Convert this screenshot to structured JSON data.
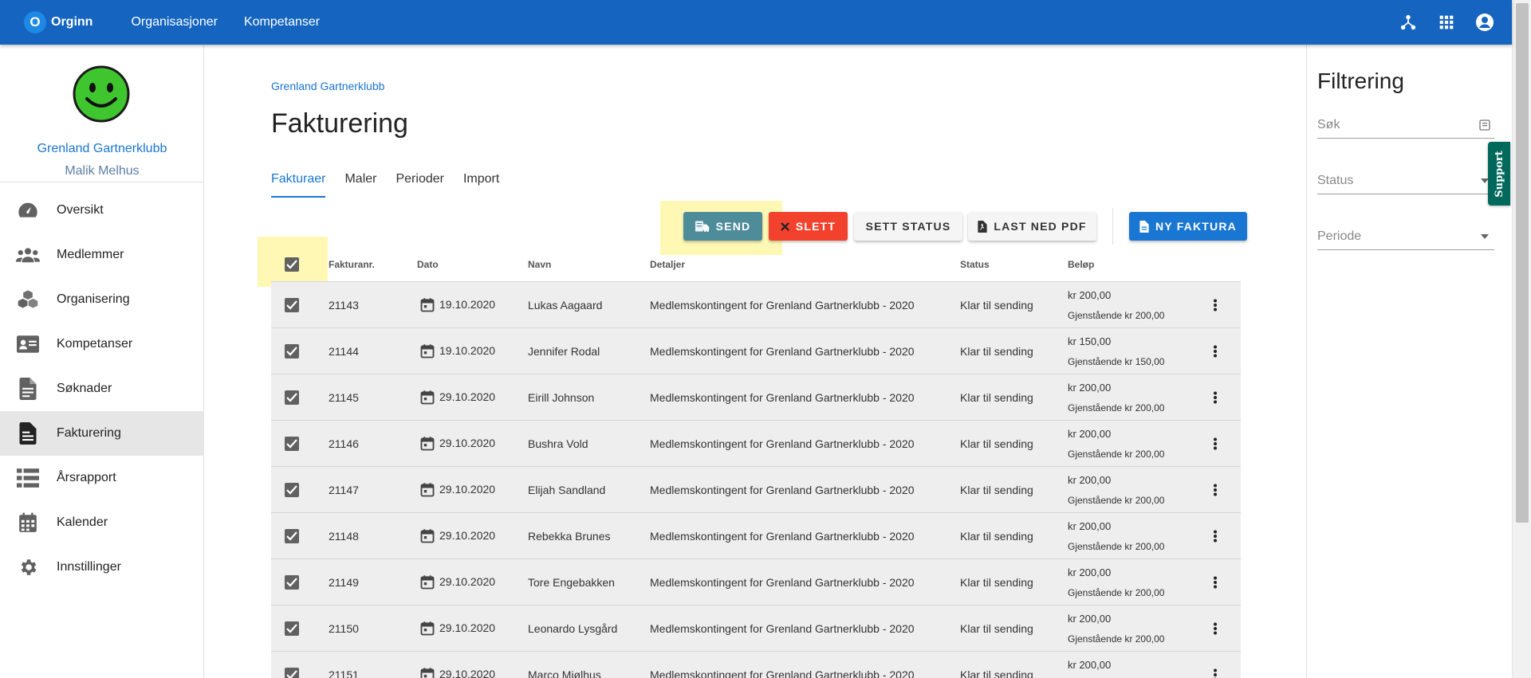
{
  "app": {
    "brand_letter": "O",
    "brand_name": "Orginn",
    "nav": [
      "Organisasjoner",
      "Kompetanser"
    ],
    "icons": [
      "hierarchy-icon",
      "apps-grid-icon",
      "account-circle-icon"
    ]
  },
  "sidebar": {
    "org_name": "Grenland Gartnerklubb",
    "user_name": "Malik Melhus",
    "items": [
      {
        "label": "Oversikt",
        "icon": "dashboard-icon"
      },
      {
        "label": "Medlemmer",
        "icon": "group-icon"
      },
      {
        "label": "Organisering",
        "icon": "boxes-icon"
      },
      {
        "label": "Kompetanser",
        "icon": "id-card-icon"
      },
      {
        "label": "Søknader",
        "icon": "document-icon"
      },
      {
        "label": "Fakturering",
        "icon": "invoice-icon",
        "active": true
      },
      {
        "label": "Årsrapport",
        "icon": "list-icon"
      },
      {
        "label": "Kalender",
        "icon": "calendar-icon"
      },
      {
        "label": "Innstillinger",
        "icon": "gear-icon"
      }
    ]
  },
  "main": {
    "breadcrumb": "Grenland Gartnerklubb",
    "title": "Fakturering",
    "tabs": [
      {
        "label": "Fakturaer",
        "active": true
      },
      {
        "label": "Maler"
      },
      {
        "label": "Perioder"
      },
      {
        "label": "Import"
      }
    ],
    "buttons": {
      "send": "SEND",
      "delete": "SLETT",
      "set_status": "SETT STATUS",
      "download_pdf": "LAST NED PDF",
      "new_invoice": "NY FAKTURA"
    },
    "table": {
      "columns": [
        "Fakturanr.",
        "Dato",
        "Navn",
        "Detaljer",
        "Status",
        "Beløp"
      ],
      "rows": [
        {
          "nr": "21143",
          "date": "19.10.2020",
          "name": "Lukas Aagaard",
          "details": "Medlemskontingent for Grenland Gartnerklubb - 2020",
          "status": "Klar til sending",
          "amount": "kr 200,00",
          "remaining": "Gjenstående kr 200,00"
        },
        {
          "nr": "21144",
          "date": "19.10.2020",
          "name": "Jennifer Rodal",
          "details": "Medlemskontingent for Grenland Gartnerklubb - 2020",
          "status": "Klar til sending",
          "amount": "kr 150,00",
          "remaining": "Gjenstående kr 150,00"
        },
        {
          "nr": "21145",
          "date": "29.10.2020",
          "name": "Eirill Johnson",
          "details": "Medlemskontingent for Grenland Gartnerklubb - 2020",
          "status": "Klar til sending",
          "amount": "kr 200,00",
          "remaining": "Gjenstående kr 200,00"
        },
        {
          "nr": "21146",
          "date": "29.10.2020",
          "name": "Bushra Vold",
          "details": "Medlemskontingent for Grenland Gartnerklubb - 2020",
          "status": "Klar til sending",
          "amount": "kr 200,00",
          "remaining": "Gjenstående kr 200,00"
        },
        {
          "nr": "21147",
          "date": "29.10.2020",
          "name": "Elijah Sandland",
          "details": "Medlemskontingent for Grenland Gartnerklubb - 2020",
          "status": "Klar til sending",
          "amount": "kr 200,00",
          "remaining": "Gjenstående kr 200,00"
        },
        {
          "nr": "21148",
          "date": "29.10.2020",
          "name": "Rebekka Brunes",
          "details": "Medlemskontingent for Grenland Gartnerklubb - 2020",
          "status": "Klar til sending",
          "amount": "kr 200,00",
          "remaining": "Gjenstående kr 200,00"
        },
        {
          "nr": "21149",
          "date": "29.10.2020",
          "name": "Tore Engebakken",
          "details": "Medlemskontingent for Grenland Gartnerklubb - 2020",
          "status": "Klar til sending",
          "amount": "kr 200,00",
          "remaining": "Gjenstående kr 200,00"
        },
        {
          "nr": "21150",
          "date": "29.10.2020",
          "name": "Leonardo Lysgård",
          "details": "Medlemskontingent for Grenland Gartnerklubb - 2020",
          "status": "Klar til sending",
          "amount": "kr 200,00",
          "remaining": "Gjenstående kr 200,00"
        },
        {
          "nr": "21151",
          "date": "29.10.2020",
          "name": "Marco Mjølhus",
          "details": "Medlemskontingent for Grenland Gartnerklubb - 2020",
          "status": "Klar til sending",
          "amount": "kr 200,00",
          "remaining": ""
        }
      ]
    }
  },
  "filter": {
    "title": "Filtrering",
    "search_label": "Søk",
    "status_label": "Status",
    "period_label": "Periode",
    "support_label": "Support"
  },
  "colors": {
    "topbar": "#1565c0",
    "send": "#4f8c9a",
    "delete": "#f2422d",
    "primary": "#1976d2",
    "support": "#00695c",
    "highlight": "#fff7a8"
  }
}
